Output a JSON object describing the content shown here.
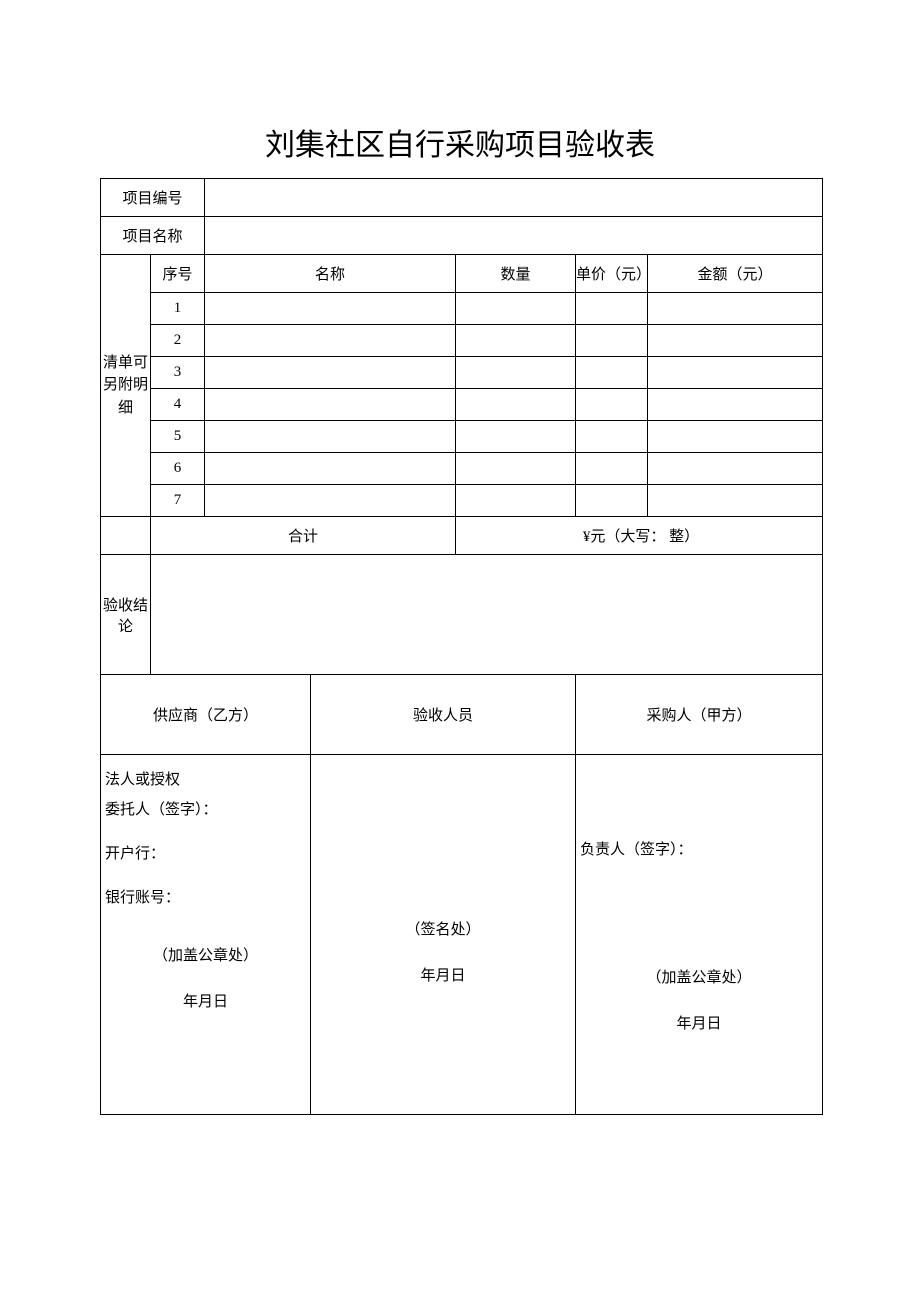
{
  "title": "刘集社区自行采购项目验收表",
  "labels": {
    "project_no": "项目编号",
    "project_name": "项目名称",
    "list_note": "清单可另附明细",
    "serial": "序号",
    "name": "名称",
    "qty": "数量",
    "unit_price": "单价（元）",
    "amount": "金额（元）",
    "total": "合计",
    "total_amount": "¥元（大写：              整）",
    "conclusion": "验收结论",
    "supplier": "供应商（乙方）",
    "inspector": "验收人员",
    "buyer": "采购人（甲方）"
  },
  "values": {
    "project_no": "",
    "project_name": "",
    "conclusion": ""
  },
  "rows": [
    {
      "no": "1",
      "name": "",
      "qty": "",
      "unit_price": "",
      "amount": ""
    },
    {
      "no": "2",
      "name": "",
      "qty": "",
      "unit_price": "",
      "amount": ""
    },
    {
      "no": "3",
      "name": "",
      "qty": "",
      "unit_price": "",
      "amount": ""
    },
    {
      "no": "4",
      "name": "",
      "qty": "",
      "unit_price": "",
      "amount": ""
    },
    {
      "no": "5",
      "name": "",
      "qty": "",
      "unit_price": "",
      "amount": ""
    },
    {
      "no": "6",
      "name": "",
      "qty": "",
      "unit_price": "",
      "amount": ""
    },
    {
      "no": "7",
      "name": "",
      "qty": "",
      "unit_price": "",
      "amount": ""
    }
  ],
  "supplier_block": {
    "line1": "法人或授权",
    "line2": "委托人（签字）：",
    "line3": "开户行：",
    "line4": "银行账号：",
    "seal": "（加盖公章处）",
    "date": "年月日"
  },
  "inspector_block": {
    "sign": "（签名处）",
    "date": "年月日"
  },
  "buyer_block": {
    "line1": "负责人（签字）：",
    "seal": "（加盖公章处）",
    "date": "年月日"
  }
}
